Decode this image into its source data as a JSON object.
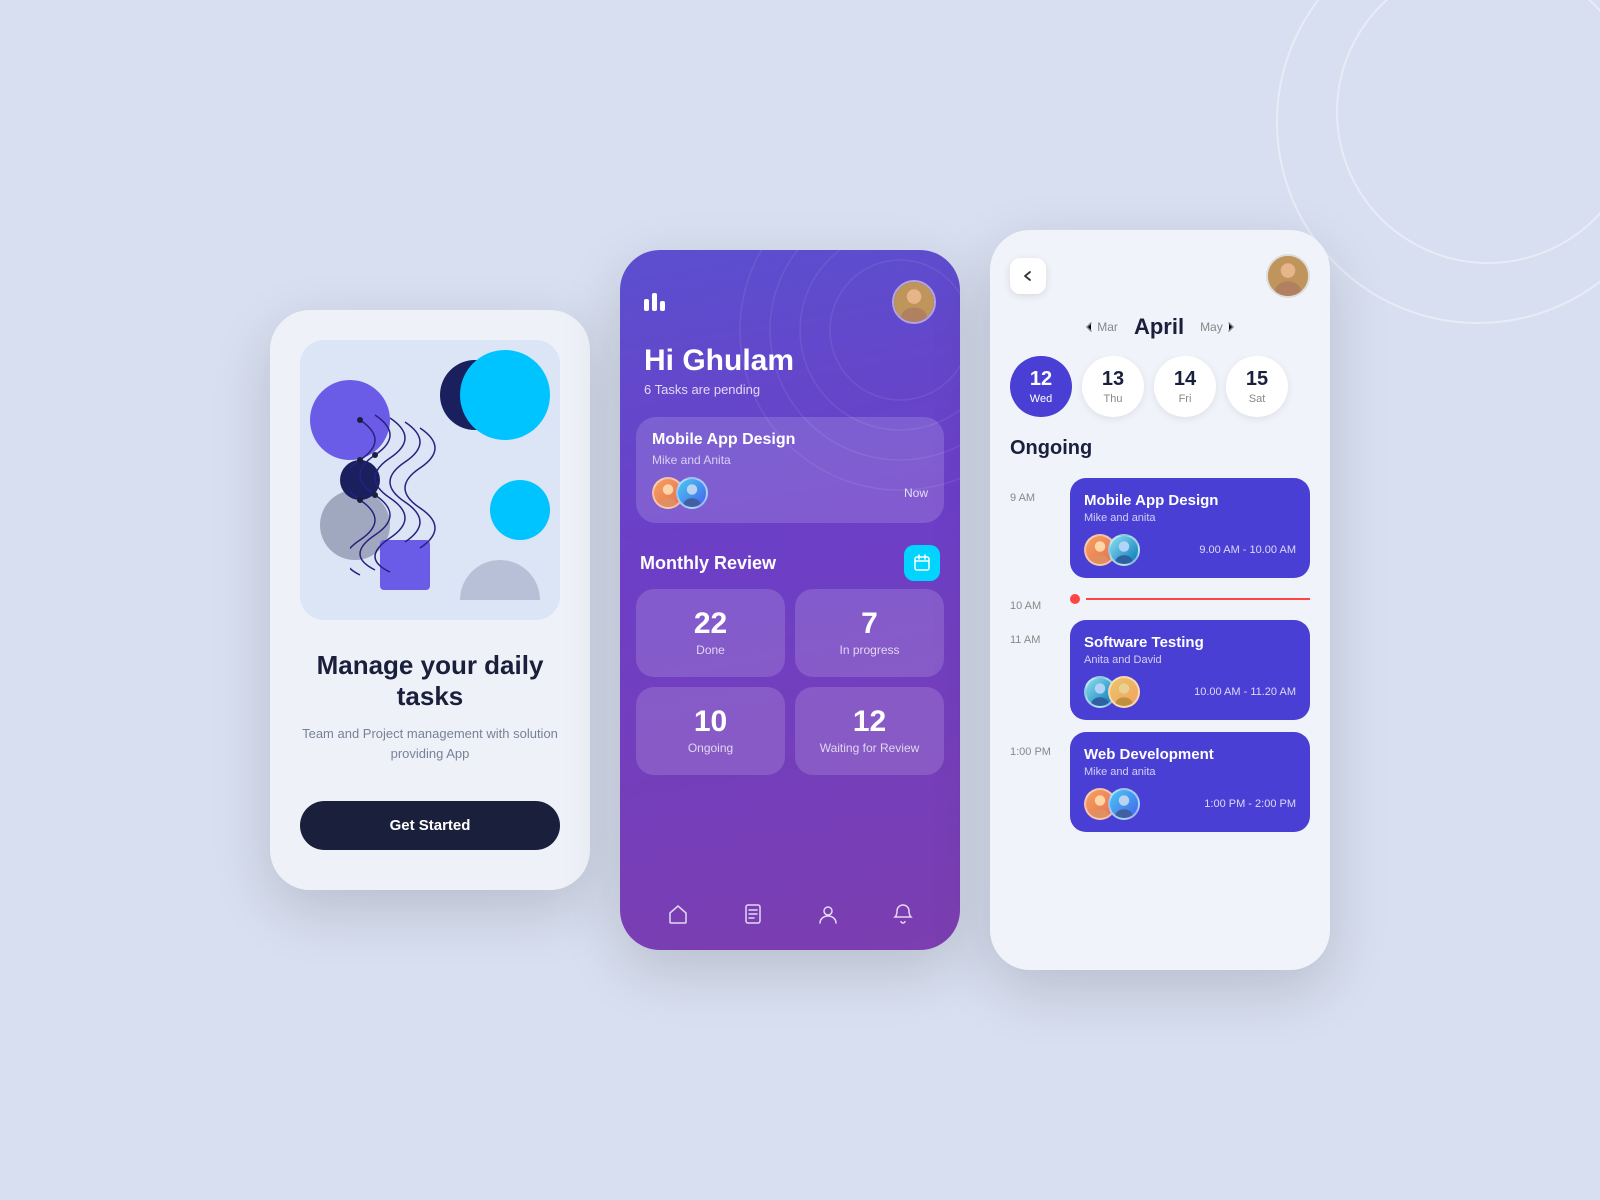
{
  "phone1": {
    "title": "Manage your\ndaily tasks",
    "subtitle": "Team and Project management with solution providing App",
    "cta": "Get Started"
  },
  "phone2": {
    "greeting": "Hi Ghulam",
    "pending": "6 Tasks are pending",
    "task": {
      "title": "Mobile App Design",
      "participants": "Mike and Anita",
      "time": "Now"
    },
    "monthly_review": {
      "label": "Monthly Review",
      "stats": [
        {
          "number": "22",
          "label": "Done"
        },
        {
          "number": "7",
          "label": "In progress"
        },
        {
          "number": "10",
          "label": "Ongoing"
        },
        {
          "number": "12",
          "label": "Waiting for Review"
        }
      ]
    },
    "nav": [
      "home",
      "document",
      "person",
      "bell"
    ]
  },
  "phone3": {
    "month": "April",
    "prev_month": "Mar",
    "next_month": "May",
    "dates": [
      {
        "number": "12",
        "day": "Wed",
        "active": true
      },
      {
        "number": "13",
        "day": "Thu",
        "active": false
      },
      {
        "number": "14",
        "day": "Fri",
        "active": false
      },
      {
        "number": "15",
        "day": "Sat",
        "active": false
      }
    ],
    "section_label": "Ongoing",
    "events": [
      {
        "time": "9 AM",
        "title": "Mobile App Design",
        "participants": "Mike and anita",
        "timeRange": "9.00 AM - 10.00 AM"
      },
      {
        "time": "10 AM",
        "title": null
      },
      {
        "time": "11 AM",
        "title": "Software Testing",
        "participants": "Anita and David",
        "timeRange": "10.00 AM - 11.20 AM"
      },
      {
        "time": "1:00 PM",
        "title": "Web Development",
        "participants": "Mike and anita",
        "timeRange": "1:00 PM - 2:00 PM"
      }
    ]
  }
}
